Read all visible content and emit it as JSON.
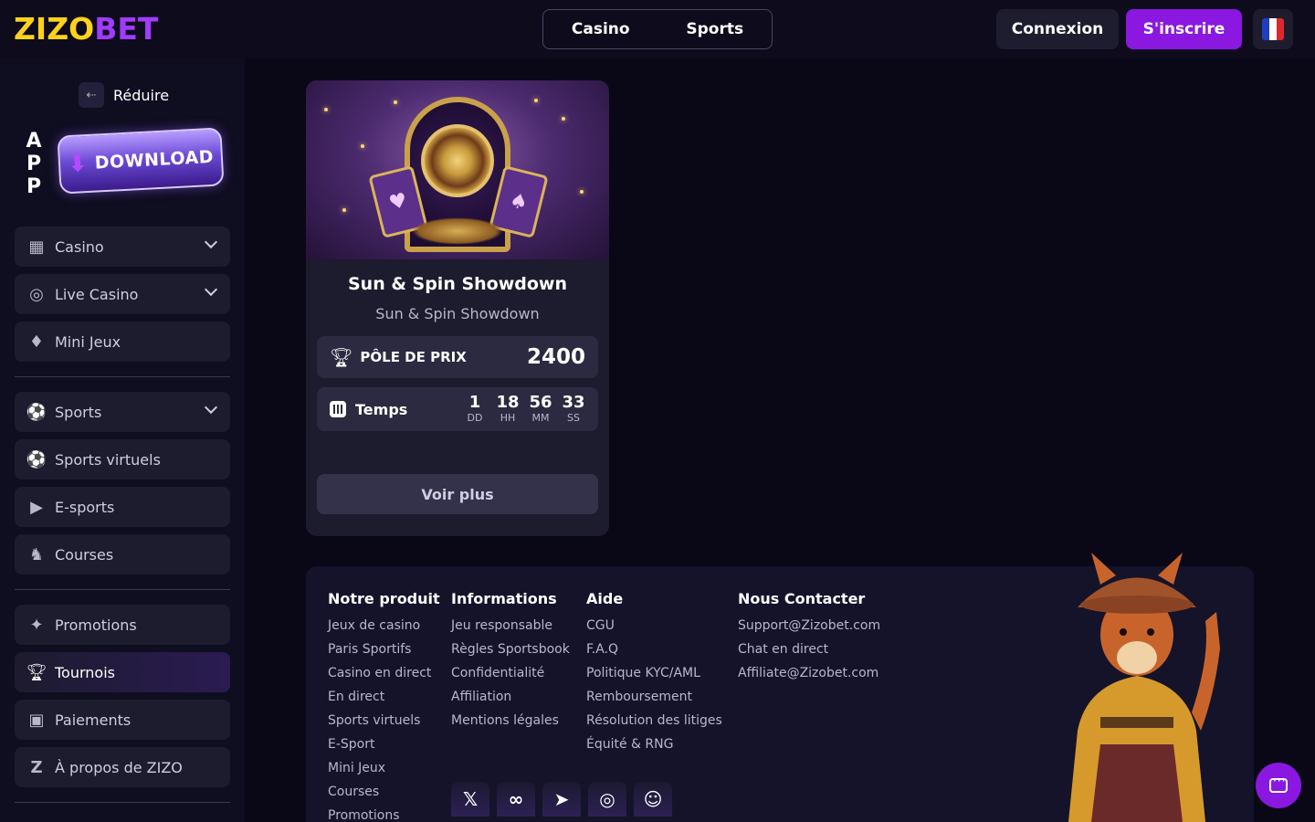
{
  "header": {
    "logo_left": "ZIZO",
    "logo_right": "BET",
    "modes": [
      "Casino",
      "Sports"
    ],
    "login_label": "Connexion",
    "signup_label": "S'inscrire",
    "language_icon": "france-flag-icon"
  },
  "sidebar": {
    "reduce_label": "Réduire",
    "app_letters": [
      "A",
      "P",
      "P"
    ],
    "download_label": "DOWNLOAD",
    "items": [
      {
        "label": "Casino",
        "icon": "slot-machine-icon",
        "expandable": true
      },
      {
        "label": "Live Casino",
        "icon": "roulette-icon",
        "expandable": true
      },
      {
        "label": "Mini Jeux",
        "icon": "diamond-icon",
        "expandable": false
      },
      {
        "label": "Sports",
        "icon": "soccer-ball-icon",
        "expandable": true
      },
      {
        "label": "Sports virtuels",
        "icon": "virtual-ball-icon",
        "expandable": false
      },
      {
        "label": "E-sports",
        "icon": "play-icon",
        "expandable": false
      },
      {
        "label": "Courses",
        "icon": "horse-icon",
        "expandable": false
      },
      {
        "label": "Promotions",
        "icon": "megaphone-icon",
        "expandable": false
      },
      {
        "label": "Tournois",
        "icon": "trophy-icon",
        "expandable": false,
        "active": true
      },
      {
        "label": "Paiements",
        "icon": "wallet-icon",
        "expandable": false
      },
      {
        "label": "À propos de ZIZO",
        "icon": "zizo-z-icon",
        "expandable": false
      }
    ]
  },
  "tournament": {
    "title": "Sun & Spin Showdown",
    "subtitle": "Sun & Spin Showdown",
    "prize_label": "PÔLE DE PRIX",
    "prize_value": "2400",
    "time_label": "Temps",
    "countdown": [
      {
        "value": "1",
        "unit": "DD"
      },
      {
        "value": "18",
        "unit": "HH"
      },
      {
        "value": "56",
        "unit": "MM"
      },
      {
        "value": "33",
        "unit": "SS"
      }
    ],
    "see_more_label": "Voir plus"
  },
  "footer": {
    "columns": [
      {
        "title": "Notre produit",
        "links": [
          "Jeux de casino",
          "Paris Sportifs",
          "Casino en direct",
          "En direct",
          "Sports virtuels",
          "E-Sport",
          "Mini Jeux",
          "Courses",
          "Promotions"
        ]
      },
      {
        "title": "Informations",
        "links": [
          "Jeu responsable",
          "Règles Sportsbook",
          "Confidentialité",
          "Affiliation",
          "Mentions légales"
        ]
      },
      {
        "title": "Aide",
        "links": [
          "CGU",
          "F.A.Q",
          "Politique KYC/AML",
          "Remboursement",
          "Résolution des litiges",
          "Équité & RNG"
        ]
      },
      {
        "title": "Nous Contacter",
        "links": [
          "Support@Zizobet.com",
          "Chat en direct",
          "Affiliate@Zizobet.com"
        ]
      }
    ],
    "socials": [
      "x-icon",
      "meta-icon",
      "telegram-icon",
      "instagram-icon",
      "discord-icon"
    ]
  },
  "colors": {
    "accent": "#8a18e0",
    "logo_yellow": "#ffd21a",
    "logo_purple": "#a13bff",
    "background": "#0a0817"
  }
}
